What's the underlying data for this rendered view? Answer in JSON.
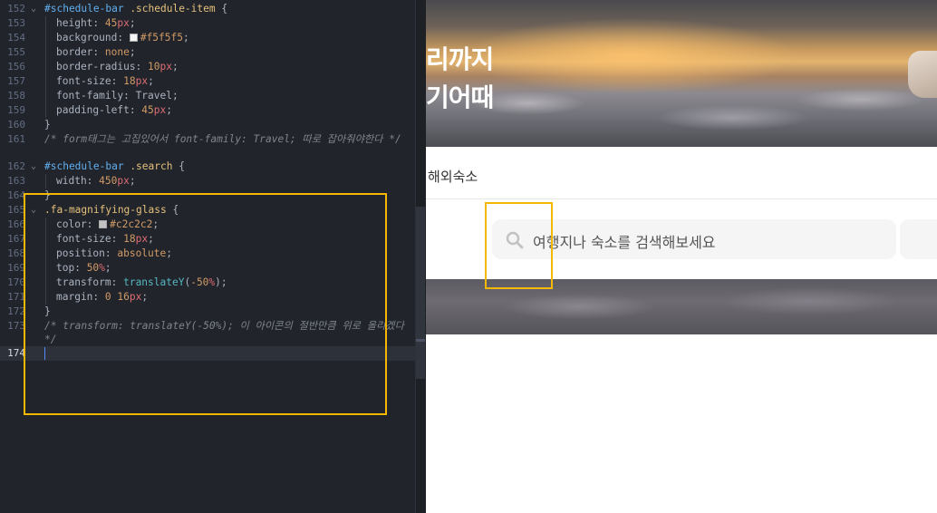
{
  "editor": {
    "lines": [
      {
        "num": "152",
        "fold": true,
        "tokens": [
          [
            "sel",
            "#schedule-bar"
          ],
          [
            "punc",
            " "
          ],
          [
            "cls",
            ".schedule-item"
          ],
          [
            "punc",
            " {"
          ]
        ]
      },
      {
        "num": "153",
        "indent": true,
        "tokens": [
          [
            "prop",
            "height: "
          ],
          [
            "num",
            "45"
          ],
          [
            "unit",
            "px"
          ],
          [
            "punc",
            ";"
          ]
        ]
      },
      {
        "num": "154",
        "indent": true,
        "swatch": "#f5f5f5",
        "tokens": [
          [
            "prop",
            "background: "
          ],
          [
            "val",
            "#f5f5f5"
          ],
          [
            "punc",
            ";"
          ]
        ]
      },
      {
        "num": "155",
        "indent": true,
        "tokens": [
          [
            "prop",
            "border: "
          ],
          [
            "kw",
            "none"
          ],
          [
            "punc",
            ";"
          ]
        ]
      },
      {
        "num": "156",
        "indent": true,
        "tokens": [
          [
            "prop",
            "border-radius: "
          ],
          [
            "num",
            "10"
          ],
          [
            "unit",
            "px"
          ],
          [
            "punc",
            ";"
          ]
        ]
      },
      {
        "num": "157",
        "indent": true,
        "tokens": [
          [
            "prop",
            "font-size: "
          ],
          [
            "num",
            "18"
          ],
          [
            "unit",
            "px"
          ],
          [
            "punc",
            ";"
          ]
        ]
      },
      {
        "num": "158",
        "indent": true,
        "tokens": [
          [
            "prop",
            "font-family: "
          ],
          [
            "prop",
            "Travel"
          ],
          [
            "punc",
            ";"
          ]
        ]
      },
      {
        "num": "159",
        "indent": true,
        "tokens": [
          [
            "prop",
            "padding-left: "
          ],
          [
            "num",
            "45"
          ],
          [
            "unit",
            "px"
          ],
          [
            "punc",
            ";"
          ]
        ]
      },
      {
        "num": "160",
        "tokens": [
          [
            "punc",
            "}"
          ]
        ]
      },
      {
        "num": "161",
        "tall": true,
        "tokens": [
          [
            "com",
            "/* form태그는 고집있어서 font-family: Travel; 따로 잡아줘야한다 */"
          ]
        ]
      },
      {
        "num": "162",
        "fold": true,
        "tokens": [
          [
            "sel",
            "#schedule-bar"
          ],
          [
            "punc",
            " "
          ],
          [
            "cls",
            ".search"
          ],
          [
            "punc",
            " {"
          ]
        ]
      },
      {
        "num": "163",
        "indent": true,
        "tokens": [
          [
            "prop",
            "width: "
          ],
          [
            "num",
            "450"
          ],
          [
            "unit",
            "px"
          ],
          [
            "punc",
            ";"
          ]
        ]
      },
      {
        "num": "164",
        "tokens": [
          [
            "punc",
            "}"
          ]
        ]
      },
      {
        "num": "165",
        "fold": true,
        "tokens": [
          [
            "cls",
            ".fa-magnifying-glass"
          ],
          [
            "punc",
            " {"
          ]
        ]
      },
      {
        "num": "166",
        "indent": true,
        "swatch": "#c2c2c2",
        "tokens": [
          [
            "prop",
            "color: "
          ],
          [
            "val",
            "#c2c2c2"
          ],
          [
            "punc",
            ";"
          ]
        ]
      },
      {
        "num": "167",
        "indent": true,
        "tokens": [
          [
            "prop",
            "font-size: "
          ],
          [
            "num",
            "18"
          ],
          [
            "unit",
            "px"
          ],
          [
            "punc",
            ";"
          ]
        ]
      },
      {
        "num": "168",
        "indent": true,
        "tokens": [
          [
            "prop",
            "position: "
          ],
          [
            "kw",
            "absolute"
          ],
          [
            "punc",
            ";"
          ]
        ]
      },
      {
        "num": "169",
        "indent": true,
        "tokens": [
          [
            "prop",
            "top: "
          ],
          [
            "num",
            "50"
          ],
          [
            "unit",
            "%"
          ],
          [
            "punc",
            ";"
          ]
        ]
      },
      {
        "num": "170",
        "indent": true,
        "tokens": [
          [
            "prop",
            "transform: "
          ],
          [
            "fn",
            "translateY"
          ],
          [
            "punc",
            "("
          ],
          [
            "num",
            "-50"
          ],
          [
            "unit",
            "%"
          ],
          [
            "punc",
            ");"
          ]
        ]
      },
      {
        "num": "171",
        "indent": true,
        "tokens": [
          [
            "prop",
            "margin: "
          ],
          [
            "num",
            "0 16"
          ],
          [
            "unit",
            "px"
          ],
          [
            "punc",
            ";"
          ]
        ]
      },
      {
        "num": "172",
        "tokens": [
          [
            "punc",
            "}"
          ]
        ]
      },
      {
        "num": "173",
        "tall": true,
        "tokens": [
          [
            "com",
            "/* transform: translateY(-50%); 이 아이콘의 절반만큼 위로 올리겠다 */"
          ]
        ]
      },
      {
        "num": "174",
        "current": true,
        "tokens": []
      }
    ]
  },
  "preview": {
    "hero_line_1": "리까지",
    "hero_line_2": "기어때",
    "nav_tab": "해외숙소",
    "search_placeholder": "여행지나 숙소를 검색해보세요"
  },
  "colors": {
    "annotation": "#f5b800",
    "search_bg": "#f5f5f5",
    "icon_color": "#c2c2c2"
  }
}
